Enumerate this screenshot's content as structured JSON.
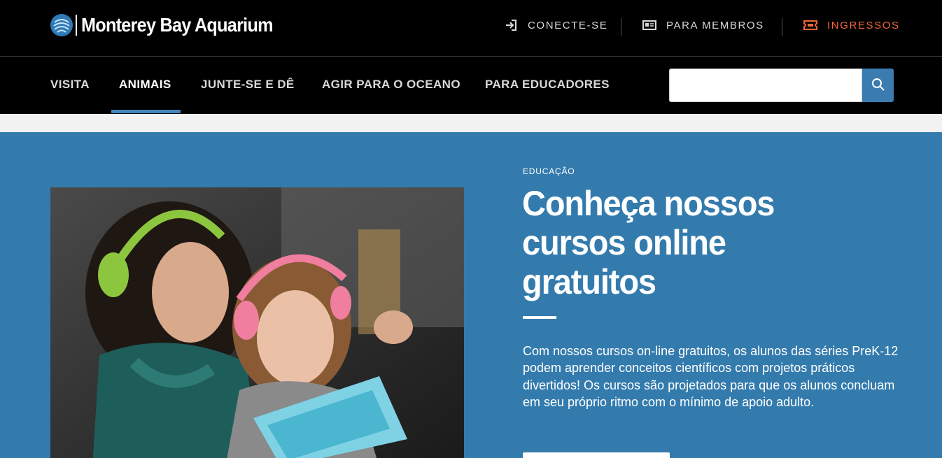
{
  "header": {
    "logo_text": "Monterey Bay Aquarium",
    "login_label": "CONECTE-SE",
    "members_label": "PARA MEMBROS",
    "tickets_label": "INGRESSOS"
  },
  "nav": {
    "items": [
      {
        "label": "VISITA"
      },
      {
        "label": "ANIMAIS"
      },
      {
        "label": "JUNTE-SE E DÊ"
      },
      {
        "label": "AGIR PARA O OCEANO"
      },
      {
        "label": "PARA EDUCADORES"
      }
    ],
    "active_index": 1
  },
  "search": {
    "value": "",
    "placeholder": ""
  },
  "hero": {
    "eyebrow": "EDUCAÇÃO",
    "title": "Conheça nossos cursos online gratuitos",
    "body": "Com nossos cursos on-line gratuitos, os alunos das séries PreK-12 podem aprender conceitos científicos com projetos práticos divertidos! Os cursos são projetados para que os alunos concluam em seu próprio ritmo com o mínimo de apoio adulto.",
    "cta_label": ""
  },
  "colors": {
    "hero_bg": "#347bad",
    "tickets_accent": "#f2663a",
    "nav_active_underline": "#3f85c0",
    "search_button": "#3a7bb0"
  },
  "icons": {
    "login": "login-arrow-icon",
    "members": "member-card-icon",
    "tickets": "ticket-icon",
    "search": "search-icon",
    "logo": "aquarium-logo-icon"
  }
}
